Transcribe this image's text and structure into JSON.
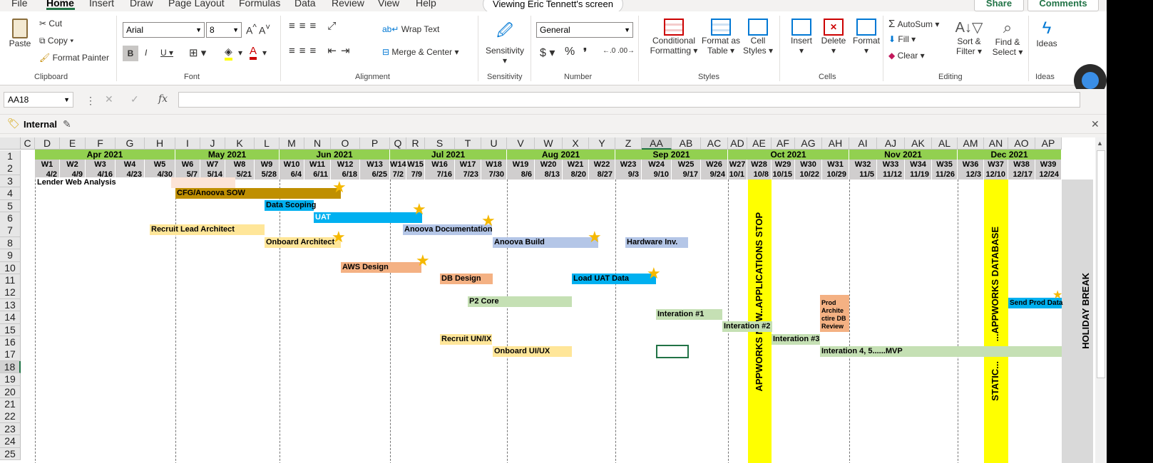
{
  "menu": {
    "file": "File",
    "home": "Home",
    "insert": "Insert",
    "draw": "Draw",
    "page_layout": "Page Layout",
    "formulas": "Formulas",
    "data": "Data",
    "review": "Review",
    "view": "View",
    "help": "Help"
  },
  "banner": "Viewing Eric Tennett's screen",
  "share": "Share",
  "comments": "Comments",
  "ribbon": {
    "clipboard": {
      "paste": "Paste",
      "cut": "Cut",
      "copy": "Copy",
      "format_painter": "Format Painter",
      "label": "Clipboard"
    },
    "font": {
      "name": "Arial",
      "size": "8",
      "label": "Font"
    },
    "alignment": {
      "wrap": "Wrap Text",
      "merge": "Merge & Center",
      "label": "Alignment"
    },
    "sensitivity": {
      "button": "Sensitivity",
      "label": "Sensitivity"
    },
    "number": {
      "format": "General",
      "label": "Number"
    },
    "styles": {
      "conditional1": "Conditional",
      "conditional2": "Formatting",
      "format_table1": "Format as",
      "format_table2": "Table",
      "cell_styles1": "Cell",
      "cell_styles2": "Styles",
      "label": "Styles"
    },
    "cells": {
      "insert": "Insert",
      "delete": "Delete",
      "format": "Format",
      "label": "Cells"
    },
    "editing": {
      "autosum": "AutoSum",
      "fill": "Fill",
      "clear": "Clear",
      "sort1": "Sort &",
      "sort2": "Filter",
      "find1": "Find &",
      "find2": "Select",
      "label": "Editing"
    },
    "ideas": {
      "button": "Ideas",
      "label": "Ideas"
    }
  },
  "namebox": "AA18",
  "sensitivity_label": "Internal",
  "columns": [
    "C",
    "D",
    "E",
    "F",
    "G",
    "H",
    "I",
    "J",
    "K",
    "L",
    "M",
    "N",
    "O",
    "P",
    "Q",
    "R",
    "S",
    "T",
    "U",
    "V",
    "W",
    "X",
    "Y",
    "Z",
    "AA",
    "AB",
    "AC",
    "AD",
    "AE",
    "AF",
    "AG",
    "AH",
    "AI",
    "AJ",
    "AK",
    "AL",
    "AM",
    "AN",
    "AO",
    "AP"
  ],
  "selected_column": "AA",
  "rows": [
    "1",
    "2",
    "3",
    "4",
    "5",
    "6",
    "7",
    "8",
    "9",
    "10",
    "11",
    "12",
    "13",
    "14",
    "15",
    "16",
    "17",
    "18",
    "19",
    "20",
    "21",
    "22",
    "23",
    "24",
    "25"
  ],
  "selected_row": "18",
  "months": [
    "Apr 2021",
    "May 2021",
    "Jun 2021",
    "Jul 2021",
    "Aug 2021",
    "Sep 2021",
    "Oct 2021",
    "Nov 2021",
    "Dec 2021"
  ],
  "weeks": [
    "W1",
    "W2",
    "W3",
    "W4",
    "W5",
    "W6",
    "W7",
    "W8",
    "W9",
    "W10",
    "W11",
    "W12",
    "W13",
    "W14",
    "W15",
    "W16",
    "W17",
    "W18",
    "W19",
    "W20",
    "W21",
    "W22",
    "W23",
    "W24",
    "W25",
    "W26",
    "W27",
    "W28",
    "W29",
    "W30",
    "W31",
    "W32",
    "W33",
    "W34",
    "W35",
    "W36",
    "W37",
    "W38",
    "W39"
  ],
  "dates": [
    "4/2",
    "4/9",
    "4/16",
    "4/23",
    "4/30",
    "5/7",
    "5/14",
    "5/21",
    "5/28",
    "6/4",
    "6/11",
    "6/18",
    "6/25",
    "7/2",
    "7/9",
    "7/16",
    "7/23",
    "7/30",
    "8/6",
    "8/13",
    "8/20",
    "8/27",
    "9/3",
    "9/10",
    "9/17",
    "9/24",
    "10/1",
    "10/8",
    "10/15",
    "10/22",
    "10/29",
    "11/5",
    "11/12",
    "11/19",
    "11/26",
    "12/3",
    "12/10",
    "12/17",
    "12/24"
  ],
  "tasks": {
    "lender": "Lender Web Analysis",
    "cfg": "CFG/Anoova SOW",
    "scoping": "Data Scoping",
    "uat": "UAT",
    "recruit_lead": "Recruit Lead Architect",
    "anoova_doc": "Anoova Documentation",
    "onboard_arch": "Onboard Architect",
    "anoova_build": "Anoova Build",
    "hardware": "Hardware Inv.",
    "aws": "AWS Design",
    "db_design": "DB Design",
    "load_uat": "Load UAT Data",
    "p2core": "P2 Core",
    "prod_review": "Prod Archite ctire DB Review",
    "send_prod": "Send Prod Data",
    "iter1": "Interation #1",
    "iter2": "Interation #2",
    "iter3": "Interation #3",
    "recruit_ux": "Recruit UN/IX",
    "onboard_ux": "Onboard UI/UX",
    "iter45": "Interation 4, 5......MVP"
  },
  "vertical": {
    "apps_new": "APPWORKS NEW...",
    "apps_stop": "...APPLICATIONS STOP",
    "static": "STATIC...",
    "appworks_db": "...APPWORKS DATABASE",
    "holiday": "HOLIDAY BREAK"
  },
  "colors": {
    "month": "#92d050",
    "grid_header": "#d0cece",
    "accent": "#217346",
    "band": "#ffff00"
  }
}
